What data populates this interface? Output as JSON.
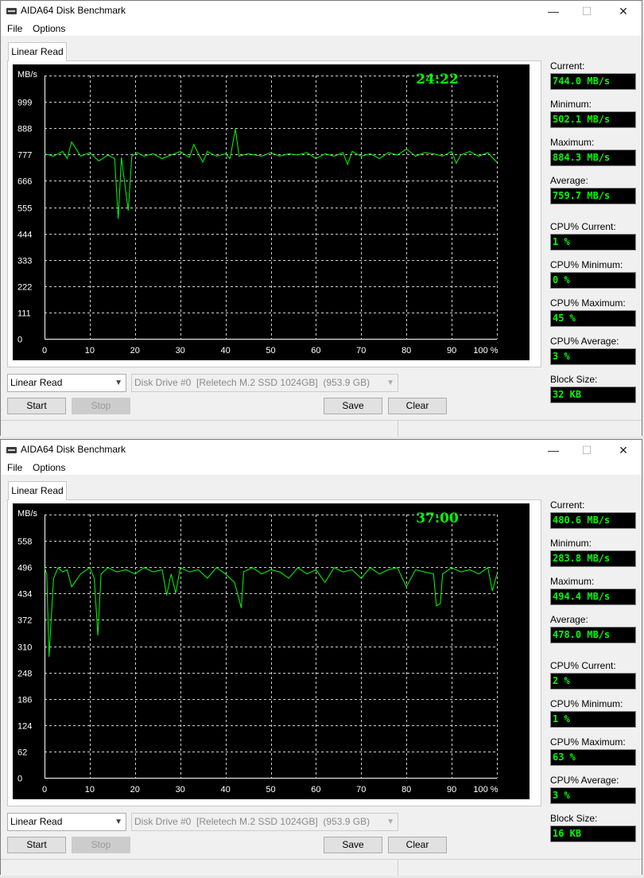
{
  "windows": [
    {
      "title": "AIDA64 Disk Benchmark",
      "menu": [
        "File",
        "Options"
      ],
      "tab": "Linear Read",
      "timer": "24:22",
      "stats": [
        {
          "label": "Current:",
          "value": "744.0 MB/s"
        },
        {
          "label": "Minimum:",
          "value": "502.1 MB/s"
        },
        {
          "label": "Maximum:",
          "value": "884.3 MB/s"
        },
        {
          "label": "Average:",
          "value": "759.7 MB/s"
        },
        {
          "label": "CPU% Current:",
          "value": "1 %"
        },
        {
          "label": "CPU% Minimum:",
          "value": "0 %"
        },
        {
          "label": "CPU% Maximum:",
          "value": "45 %"
        },
        {
          "label": "CPU% Average:",
          "value": "3 %"
        },
        {
          "label": "Block Size:",
          "value": "32 KB"
        }
      ],
      "test_select": "Linear Read",
      "drive_select": "Disk Drive #0  [Reletech M.2 SSD 1024GB]  (953.9 GB)",
      "buttons": {
        "start": "Start",
        "stop": "Stop",
        "save": "Save",
        "clear": "Clear"
      },
      "chart_data": {
        "type": "line",
        "ylabel": "MB/s",
        "y_ticks": [
          0,
          111,
          222,
          333,
          444,
          555,
          666,
          777,
          888,
          999
        ],
        "x_ticks": [
          "0",
          "10",
          "20",
          "30",
          "40",
          "50",
          "60",
          "70",
          "80",
          "90",
          "100 %"
        ],
        "xlim": [
          0,
          100
        ],
        "ylim": [
          0,
          1110
        ],
        "grid": true,
        "series": [
          {
            "color": "#00ff00",
            "x": [
              0,
              2,
              4,
              5,
              6,
              8,
              10,
              12,
              14,
              15.5,
              16.3,
              17,
              18.5,
              19.3,
              20.5,
              22,
              24,
              26,
              28,
              30,
              32,
              33,
              34,
              35,
              36,
              38,
              40,
              41,
              42.2,
              43,
              45,
              48,
              50,
              52,
              54,
              56,
              58,
              60,
              62,
              64,
              66,
              67,
              68,
              70,
              72,
              74,
              76,
              78,
              80,
              82,
              84,
              86,
              88,
              90,
              91,
              92,
              94,
              96,
              98,
              100
            ],
            "y": [
              780,
              770,
              790,
              760,
              830,
              770,
              785,
              750,
              775,
              760,
              505,
              765,
              540,
              770,
              785,
              770,
              780,
              760,
              775,
              790,
              765,
              820,
              780,
              745,
              790,
              770,
              780,
              760,
              885,
              770,
              780,
              770,
              785,
              770,
              780,
              775,
              785,
              760,
              780,
              770,
              785,
              735,
              790,
              770,
              780,
              760,
              785,
              775,
              800,
              770,
              785,
              780,
              770,
              790,
              740,
              775,
              790,
              770,
              785,
              744
            ]
          }
        ]
      }
    },
    {
      "title": "AIDA64 Disk Benchmark",
      "menu": [
        "File",
        "Options"
      ],
      "tab": "Linear Read",
      "timer": "37:00",
      "stats": [
        {
          "label": "Current:",
          "value": "480.6 MB/s"
        },
        {
          "label": "Minimum:",
          "value": "283.8 MB/s"
        },
        {
          "label": "Maximum:",
          "value": "494.4 MB/s"
        },
        {
          "label": "Average:",
          "value": "478.0 MB/s"
        },
        {
          "label": "CPU% Current:",
          "value": "2 %"
        },
        {
          "label": "CPU% Minimum:",
          "value": "1 %"
        },
        {
          "label": "CPU% Maximum:",
          "value": "63 %"
        },
        {
          "label": "CPU% Average:",
          "value": "3 %"
        },
        {
          "label": "Block Size:",
          "value": "16 KB"
        }
      ],
      "test_select": "Linear Read",
      "drive_select": "Disk Drive #0  [Reletech M.2 SSD 1024GB]  (953.9 GB)",
      "buttons": {
        "start": "Start",
        "stop": "Stop",
        "save": "Save",
        "clear": "Clear"
      },
      "chart_data": {
        "type": "line",
        "ylabel": "MB/s",
        "y_ticks": [
          0,
          62,
          124,
          186,
          248,
          310,
          372,
          434,
          496,
          558
        ],
        "x_ticks": [
          "0",
          "10",
          "20",
          "30",
          "40",
          "50",
          "60",
          "70",
          "80",
          "90",
          "100 %"
        ],
        "xlim": [
          0,
          100
        ],
        "ylim": [
          0,
          620
        ],
        "grid": true,
        "series": [
          {
            "color": "#00ff00",
            "x": [
              0,
              0.5,
              1,
              2,
              3,
              4,
              5,
              6,
              8,
              10,
              11,
              11.8,
              12.5,
              14,
              16,
              18,
              20,
              22,
              24,
              26,
              27,
              28,
              29,
              30,
              32,
              34,
              36,
              38,
              40,
              42,
              43.5,
              44,
              46,
              48,
              50,
              52,
              54,
              56,
              58,
              60,
              62,
              64,
              66,
              68,
              70,
              72,
              74,
              76,
              78,
              80,
              82,
              84,
              86,
              86.6,
              87.5,
              88,
              90,
              92,
              94,
              96,
              98,
              99,
              100
            ],
            "y": [
              495,
              480,
              285,
              470,
              495,
              485,
              490,
              450,
              480,
              495,
              470,
              335,
              480,
              495,
              485,
              490,
              480,
              495,
              485,
              490,
              430,
              480,
              435,
              495,
              485,
              490,
              470,
              495,
              480,
              460,
              400,
              485,
              495,
              480,
              490,
              485,
              470,
              495,
              480,
              490,
              460,
              495,
              485,
              490,
              470,
              495,
              480,
              490,
              495,
              450,
              490,
              485,
              480,
              405,
              410,
              480,
              495,
              485,
              490,
              480,
              495,
              440,
              480
            ]
          }
        ]
      }
    }
  ]
}
